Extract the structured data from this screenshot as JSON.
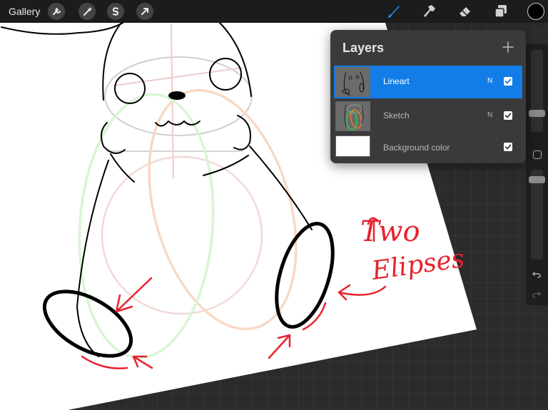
{
  "toolbar": {
    "gallery_label": "Gallery",
    "left_icons": [
      "wrench-icon",
      "magic-wand-icon",
      "selection-s-icon",
      "transform-arrow-icon"
    ],
    "right_icons": [
      "brush-icon",
      "smudge-icon",
      "eraser-icon",
      "layers-icon",
      "color-swatch"
    ],
    "active_tool": "brush",
    "accent_color": "#1a8cff",
    "current_color": "#000000"
  },
  "layers_panel": {
    "title": "Layers",
    "add_icon": "plus-icon",
    "layers": [
      {
        "name": "Lineart",
        "mode": "N",
        "visible": true,
        "active": true
      },
      {
        "name": "Sketch",
        "mode": "N",
        "visible": true,
        "active": false
      },
      {
        "name": "Background color",
        "mode": "",
        "visible": true,
        "active": false
      }
    ]
  },
  "sidebar": {
    "brush_size_level": 0.7,
    "opacity_level": 0.95,
    "icons": [
      "modify-square-icon",
      "undo-icon",
      "redo-icon"
    ]
  },
  "annotation": {
    "line1": "Two",
    "line2": "Elipses",
    "color": "#e8222e"
  }
}
